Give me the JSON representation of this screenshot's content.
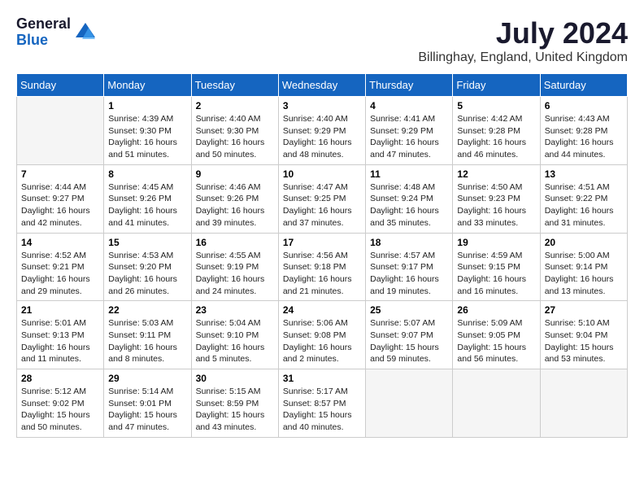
{
  "logo": {
    "general": "General",
    "blue": "Blue"
  },
  "title": {
    "month_year": "July 2024",
    "location": "Billinghay, England, United Kingdom"
  },
  "weekdays": [
    "Sunday",
    "Monday",
    "Tuesday",
    "Wednesday",
    "Thursday",
    "Friday",
    "Saturday"
  ],
  "weeks": [
    [
      {
        "day": null,
        "info": null
      },
      {
        "day": "1",
        "info": "Sunrise: 4:39 AM\nSunset: 9:30 PM\nDaylight: 16 hours\nand 51 minutes."
      },
      {
        "day": "2",
        "info": "Sunrise: 4:40 AM\nSunset: 9:30 PM\nDaylight: 16 hours\nand 50 minutes."
      },
      {
        "day": "3",
        "info": "Sunrise: 4:40 AM\nSunset: 9:29 PM\nDaylight: 16 hours\nand 48 minutes."
      },
      {
        "day": "4",
        "info": "Sunrise: 4:41 AM\nSunset: 9:29 PM\nDaylight: 16 hours\nand 47 minutes."
      },
      {
        "day": "5",
        "info": "Sunrise: 4:42 AM\nSunset: 9:28 PM\nDaylight: 16 hours\nand 46 minutes."
      },
      {
        "day": "6",
        "info": "Sunrise: 4:43 AM\nSunset: 9:28 PM\nDaylight: 16 hours\nand 44 minutes."
      }
    ],
    [
      {
        "day": "7",
        "info": "Sunrise: 4:44 AM\nSunset: 9:27 PM\nDaylight: 16 hours\nand 42 minutes."
      },
      {
        "day": "8",
        "info": "Sunrise: 4:45 AM\nSunset: 9:26 PM\nDaylight: 16 hours\nand 41 minutes."
      },
      {
        "day": "9",
        "info": "Sunrise: 4:46 AM\nSunset: 9:26 PM\nDaylight: 16 hours\nand 39 minutes."
      },
      {
        "day": "10",
        "info": "Sunrise: 4:47 AM\nSunset: 9:25 PM\nDaylight: 16 hours\nand 37 minutes."
      },
      {
        "day": "11",
        "info": "Sunrise: 4:48 AM\nSunset: 9:24 PM\nDaylight: 16 hours\nand 35 minutes."
      },
      {
        "day": "12",
        "info": "Sunrise: 4:50 AM\nSunset: 9:23 PM\nDaylight: 16 hours\nand 33 minutes."
      },
      {
        "day": "13",
        "info": "Sunrise: 4:51 AM\nSunset: 9:22 PM\nDaylight: 16 hours\nand 31 minutes."
      }
    ],
    [
      {
        "day": "14",
        "info": "Sunrise: 4:52 AM\nSunset: 9:21 PM\nDaylight: 16 hours\nand 29 minutes."
      },
      {
        "day": "15",
        "info": "Sunrise: 4:53 AM\nSunset: 9:20 PM\nDaylight: 16 hours\nand 26 minutes."
      },
      {
        "day": "16",
        "info": "Sunrise: 4:55 AM\nSunset: 9:19 PM\nDaylight: 16 hours\nand 24 minutes."
      },
      {
        "day": "17",
        "info": "Sunrise: 4:56 AM\nSunset: 9:18 PM\nDaylight: 16 hours\nand 21 minutes."
      },
      {
        "day": "18",
        "info": "Sunrise: 4:57 AM\nSunset: 9:17 PM\nDaylight: 16 hours\nand 19 minutes."
      },
      {
        "day": "19",
        "info": "Sunrise: 4:59 AM\nSunset: 9:15 PM\nDaylight: 16 hours\nand 16 minutes."
      },
      {
        "day": "20",
        "info": "Sunrise: 5:00 AM\nSunset: 9:14 PM\nDaylight: 16 hours\nand 13 minutes."
      }
    ],
    [
      {
        "day": "21",
        "info": "Sunrise: 5:01 AM\nSunset: 9:13 PM\nDaylight: 16 hours\nand 11 minutes."
      },
      {
        "day": "22",
        "info": "Sunrise: 5:03 AM\nSunset: 9:11 PM\nDaylight: 16 hours\nand 8 minutes."
      },
      {
        "day": "23",
        "info": "Sunrise: 5:04 AM\nSunset: 9:10 PM\nDaylight: 16 hours\nand 5 minutes."
      },
      {
        "day": "24",
        "info": "Sunrise: 5:06 AM\nSunset: 9:08 PM\nDaylight: 16 hours\nand 2 minutes."
      },
      {
        "day": "25",
        "info": "Sunrise: 5:07 AM\nSunset: 9:07 PM\nDaylight: 15 hours\nand 59 minutes."
      },
      {
        "day": "26",
        "info": "Sunrise: 5:09 AM\nSunset: 9:05 PM\nDaylight: 15 hours\nand 56 minutes."
      },
      {
        "day": "27",
        "info": "Sunrise: 5:10 AM\nSunset: 9:04 PM\nDaylight: 15 hours\nand 53 minutes."
      }
    ],
    [
      {
        "day": "28",
        "info": "Sunrise: 5:12 AM\nSunset: 9:02 PM\nDaylight: 15 hours\nand 50 minutes."
      },
      {
        "day": "29",
        "info": "Sunrise: 5:14 AM\nSunset: 9:01 PM\nDaylight: 15 hours\nand 47 minutes."
      },
      {
        "day": "30",
        "info": "Sunrise: 5:15 AM\nSunset: 8:59 PM\nDaylight: 15 hours\nand 43 minutes."
      },
      {
        "day": "31",
        "info": "Sunrise: 5:17 AM\nSunset: 8:57 PM\nDaylight: 15 hours\nand 40 minutes."
      },
      {
        "day": null,
        "info": null
      },
      {
        "day": null,
        "info": null
      },
      {
        "day": null,
        "info": null
      }
    ]
  ]
}
